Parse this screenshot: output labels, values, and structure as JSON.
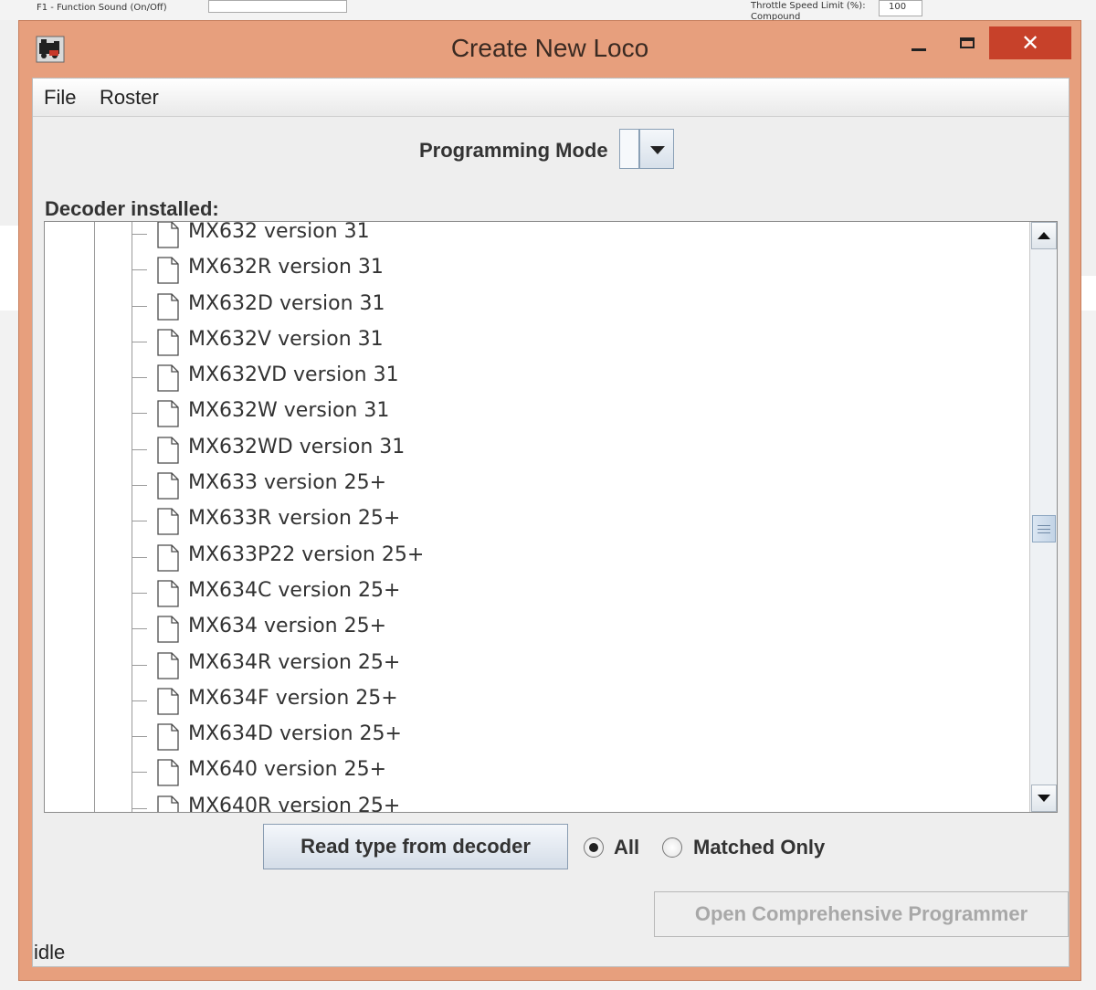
{
  "window": {
    "title": "Create New Loco",
    "close_glyph": "✕"
  },
  "menu": {
    "file": "File",
    "roster": "Roster"
  },
  "programming_mode": {
    "label": "Programming Mode",
    "selected": ""
  },
  "decoder": {
    "label": "Decoder installed:",
    "items": [
      "MX632 version 31",
      "MX632R version 31",
      "MX632D version 31",
      "MX632V version 31",
      "MX632VD version 31",
      "MX632W version 31",
      "MX632WD version 31",
      "MX633 version 25+",
      "MX633R version 25+",
      "MX633P22 version 25+",
      "MX634C version 25+",
      "MX634 version 25+",
      "MX634R version 25+",
      "MX634F version 25+",
      "MX634D version 25+",
      "MX640 version 25+",
      "MX640R version 25+"
    ]
  },
  "actions": {
    "read_type": "Read type from decoder",
    "radio_all": "All",
    "radio_matched": "Matched Only",
    "selected_filter": "All",
    "open_programmer": "Open Comprehensive Programmer"
  },
  "status": "idle",
  "background_app": {
    "text_1": "F1 - Function Sound (On/Off)",
    "text_2": "Throttle Speed Limit (%):",
    "text_3": "100",
    "text_4": "Compound"
  },
  "colors": {
    "window_frame": "#e79f7d",
    "close_button": "#c7412a",
    "client_background": "#eeeeee"
  }
}
